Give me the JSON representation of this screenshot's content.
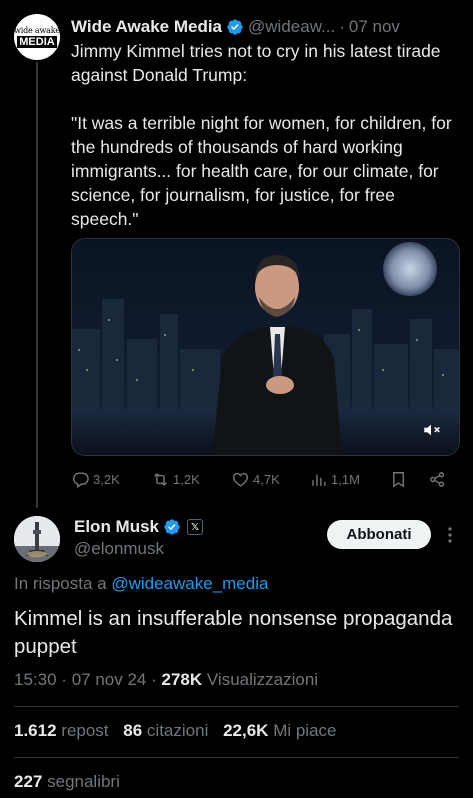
{
  "parent_tweet": {
    "avatar_top": "wide awake",
    "avatar_bottom": "MEDIA",
    "name": "Wide Awake Media",
    "handle": "@wideaw...",
    "date": "07 nov",
    "text": "Jimmy Kimmel tries not to cry in his latest tirade against Donald Trump:\n\n\"It was a terrible night for women, for children, for the hundreds of thousands of hard working immigrants... for health care, for our climate, for science, for journalism, for justice, for free speech.\"",
    "replies": "3,2K",
    "reposts": "1,2K",
    "likes": "4,7K",
    "views": "1,1M"
  },
  "main_tweet": {
    "name": "Elon Musk",
    "x_badge": "𝕏",
    "handle": "@elonmusk",
    "follow_label": "Abbonati",
    "reply_prefix": "In risposta a ",
    "reply_mention": "@wideawake_media",
    "text": "Kimmel is an insufferable nonsense propaganda puppet",
    "time": "15:30",
    "date": "07 nov 24",
    "views_count": "278K",
    "views_label": "Visualizzazioni",
    "reposts_count": "1.612",
    "reposts_label": "repost",
    "quotes_count": "86",
    "quotes_label": "citazioni",
    "likes_count": "22,6K",
    "likes_label": "Mi piace",
    "bookmarks_count": "227",
    "bookmarks_label": "segnalibri"
  },
  "colors": {
    "background": "#000000",
    "text": "#e7e9ea",
    "muted": "#71767b",
    "link": "#1d9bf0",
    "verified": "#1d9bf0"
  }
}
